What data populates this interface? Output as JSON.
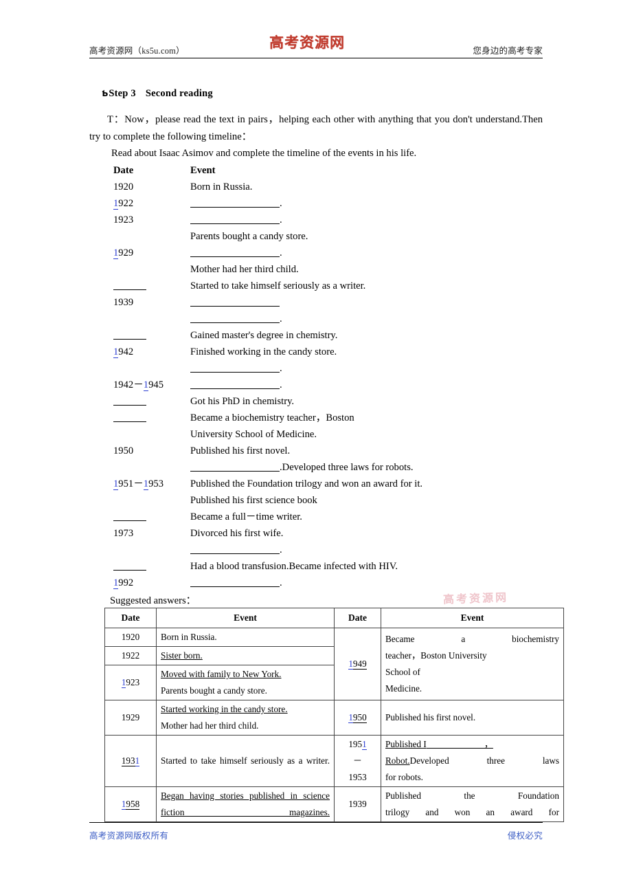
{
  "header": {
    "left": "高考资源网（ks5u.com）",
    "logo": "高考资源网",
    "right": "您身边的高考专家"
  },
  "footer": {
    "left": "高考资源网版权所有",
    "right": "侵权必究"
  },
  "watermark": "高考资源网",
  "content": {
    "step_marker": "Ƅ",
    "step_title": "Step 3",
    "step_subtitle": "Second reading",
    "teacher_line": "T：Now，please read the text in pairs，helping each other with anything that you don't understand.Then try to complete the following timeline：",
    "read_about": "Read about Isaac Asimov and complete the timeline of the events in his life.",
    "suggested_label": "Suggested answers："
  },
  "timeline": {
    "header": {
      "date": "Date",
      "event": "Event"
    },
    "rows": [
      {
        "date": "1920",
        "date_blue": "",
        "event": "Born in Russia.",
        "event_blank": false,
        "indent": false
      },
      {
        "date": "1922",
        "date_blue": "1",
        "event": "",
        "event_blank": true,
        "blank_dot": true,
        "indent": true
      },
      {
        "date": "1923",
        "date_blue": "",
        "event": "",
        "event_blank": true,
        "blank_dot": true,
        "indent": true
      },
      {
        "date": "",
        "date_blue": "",
        "event": "Parents bought a candy store.",
        "event_blank": false,
        "indent": true
      },
      {
        "date": "1929",
        "date_blue": "1",
        "event": "",
        "event_blank": true,
        "blank_dot": true,
        "indent": true
      },
      {
        "date": "",
        "date_blue": "",
        "event": "Mother had her third child.",
        "event_blank": false,
        "indent": true
      },
      {
        "date": "___",
        "date_blue": "",
        "date_is_blank": true,
        "event": "Started to take himself seriously as a writer.",
        "event_blank": false,
        "indent": true
      },
      {
        "date": "1939",
        "date_blue": "",
        "event": "",
        "event_blank": true,
        "blank_dot": false,
        "indent": true
      },
      {
        "date": "",
        "date_blue": "",
        "event": "",
        "event_blank": true,
        "blank_dot": true,
        "indent": true
      },
      {
        "date": "___",
        "date_blue": "",
        "date_is_blank": true,
        "event": "Gained master's degree in chemistry.",
        "event_blank": false,
        "indent": true
      },
      {
        "date": "1942",
        "date_blue": "1",
        "event": "Finished working in the candy store.",
        "event_blank": false,
        "indent": true
      },
      {
        "date": "",
        "date_blue": "",
        "event": "",
        "event_blank": true,
        "blank_dot": true,
        "indent": true
      },
      {
        "date": "1942－1945",
        "date_blue": "split",
        "event": "",
        "event_blank": true,
        "blank_dot": true,
        "indent": true
      },
      {
        "date": "___",
        "date_blue": "",
        "date_is_blank": true,
        "event": "Got his PhD in chemistry.",
        "event_blank": false,
        "indent": true
      },
      {
        "date": "___",
        "date_blue": "",
        "date_is_blank": true,
        "event": "Became a biochemistry teacher，Boston",
        "event_blank": false,
        "indent": true
      },
      {
        "date": "",
        "date_blue": "",
        "event": "University School of Medicine.",
        "event_blank": false,
        "indent": true
      },
      {
        "date": "1950",
        "date_blue": "",
        "event": "Published his first novel.",
        "event_blank": false,
        "indent": true
      },
      {
        "date": "",
        "date_blue": "",
        "event": ".Developed three laws for robots.",
        "event_blank": true,
        "blank_dot": false,
        "indent": true
      },
      {
        "date": "1951－1953",
        "date_blue": "split2",
        "event": "Published the Foundation trilogy and won an award for it.",
        "event_blank": false,
        "indent": true
      },
      {
        "date": "",
        "date_blue": "",
        "event": "Published his first science book",
        "event_blank": false,
        "indent": true
      },
      {
        "date": "___",
        "date_blue": "",
        "date_is_blank": true,
        "event": "Became a full－time writer.",
        "event_blank": false,
        "indent": true
      },
      {
        "date": "1973",
        "date_blue": "",
        "event": "Divorced his first wife.",
        "event_blank": false,
        "indent": true
      },
      {
        "date": "",
        "date_blue": "",
        "event": "",
        "event_blank": true,
        "blank_dot": true,
        "indent": true
      },
      {
        "date": "___",
        "date_blue": "",
        "date_is_blank": true,
        "event": "Had a blood transfusion.Became infected with HIV.",
        "event_blank": false,
        "indent": true
      },
      {
        "date": "1992",
        "date_blue": "1",
        "event": "",
        "event_blank": true,
        "blank_dot": true,
        "indent": true
      }
    ]
  },
  "answers_table": {
    "headers": [
      "Date",
      "Event",
      "Date",
      "Event"
    ],
    "left_rows": [
      {
        "date": "1920",
        "blue": "",
        "lines": [
          {
            "text": "Born in Russia.",
            "underline": false
          }
        ]
      },
      {
        "date": "1922",
        "blue": "",
        "lines": [
          {
            "text": "Sister born.",
            "underline": true
          }
        ]
      },
      {
        "date": "1923",
        "blue": "first",
        "lines": [
          {
            "text": "Moved with family to New York.",
            "underline": true
          },
          {
            "text": "Parents bought a candy store.",
            "underline": false
          }
        ]
      },
      {
        "date": "1929",
        "blue": "",
        "lines": [
          {
            "text": "Started working in the candy store.",
            "underline": true
          },
          {
            "text": "Mother had her third child.",
            "underline": false
          }
        ]
      },
      {
        "date": "1931",
        "blue": "last",
        "underline_date": true,
        "lines": [
          {
            "text": "Started to take himself seriously as a writer.",
            "underline": false,
            "justify": true
          }
        ]
      },
      {
        "date": "1958",
        "blue": "first",
        "underline_date": true,
        "lines": [
          {
            "text": "Began having stories published in science fiction magazines.",
            "underline": true,
            "justify": true
          }
        ]
      }
    ],
    "right_rows": [
      {
        "date": "1949",
        "blue": "first",
        "underline_date": true,
        "lines": [
          {
            "text": "Became a biochemistry",
            "underline": false,
            "justify": true
          },
          {
            "text": "teacher，Boston University",
            "underline": false,
            "justify": false
          },
          {
            "text": "School of",
            "underline": false,
            "justify": false
          },
          {
            "text": "Medicine.",
            "underline": false,
            "justify": false
          }
        ]
      },
      {
        "date": "1950",
        "blue": "first",
        "lines": [
          {
            "text": "Published his first novel.",
            "underline": false
          }
        ]
      },
      {
        "date": "1951\n－\n1953",
        "blue": "1951last",
        "lines": [
          {
            "text": "Published I",
            "underline": true,
            "trailing_blank": true,
            "trailing": "，"
          },
          {
            "text": "Robot.",
            "underline": true,
            "rest": "Developed three laws",
            "justify": true
          },
          {
            "text": "for robots.",
            "underline": false
          }
        ]
      },
      {
        "date": "1939",
        "blue": "",
        "lines": [
          {
            "text": "Published the Foundation",
            "underline": false,
            "justify": true
          },
          {
            "text": "trilogy and won an award for",
            "underline": false,
            "justify": true
          }
        ]
      }
    ]
  }
}
